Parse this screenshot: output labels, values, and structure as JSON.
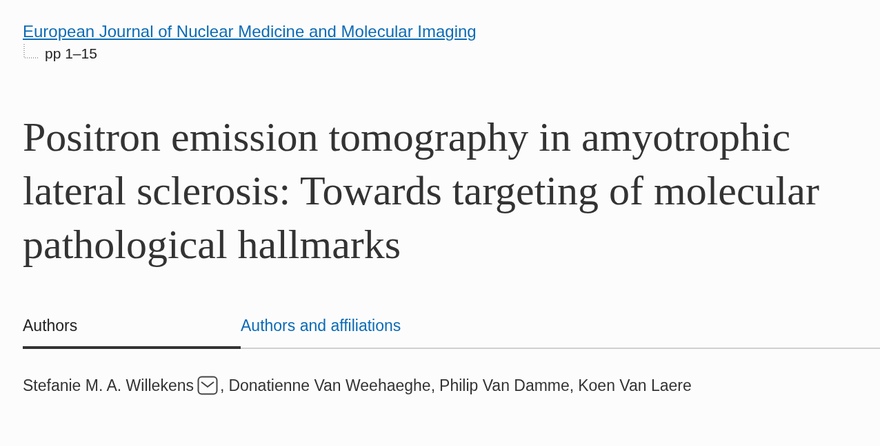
{
  "journal": {
    "link": "European Journal of Nuclear Medicine and Molecular Imaging",
    "pages": "pp 1–15"
  },
  "title": "Positron emission tomography in amyotrophic lateral sclerosis: Towards targeting of molecular pathological hallmarks",
  "tabs": [
    {
      "label": "Authors",
      "selected": true
    },
    {
      "label": "Authors and affiliations",
      "selected": false
    }
  ],
  "authors": [
    {
      "name": "Stefanie M. A. Willekens",
      "email": true,
      "separator": ","
    },
    {
      "name": "Donatienne Van Weehaeghe",
      "email": false,
      "separator": ","
    },
    {
      "name": "Philip Van Damme",
      "email": false,
      "separator": ","
    },
    {
      "name": "Koen Van Laere",
      "email": false
    }
  ]
}
